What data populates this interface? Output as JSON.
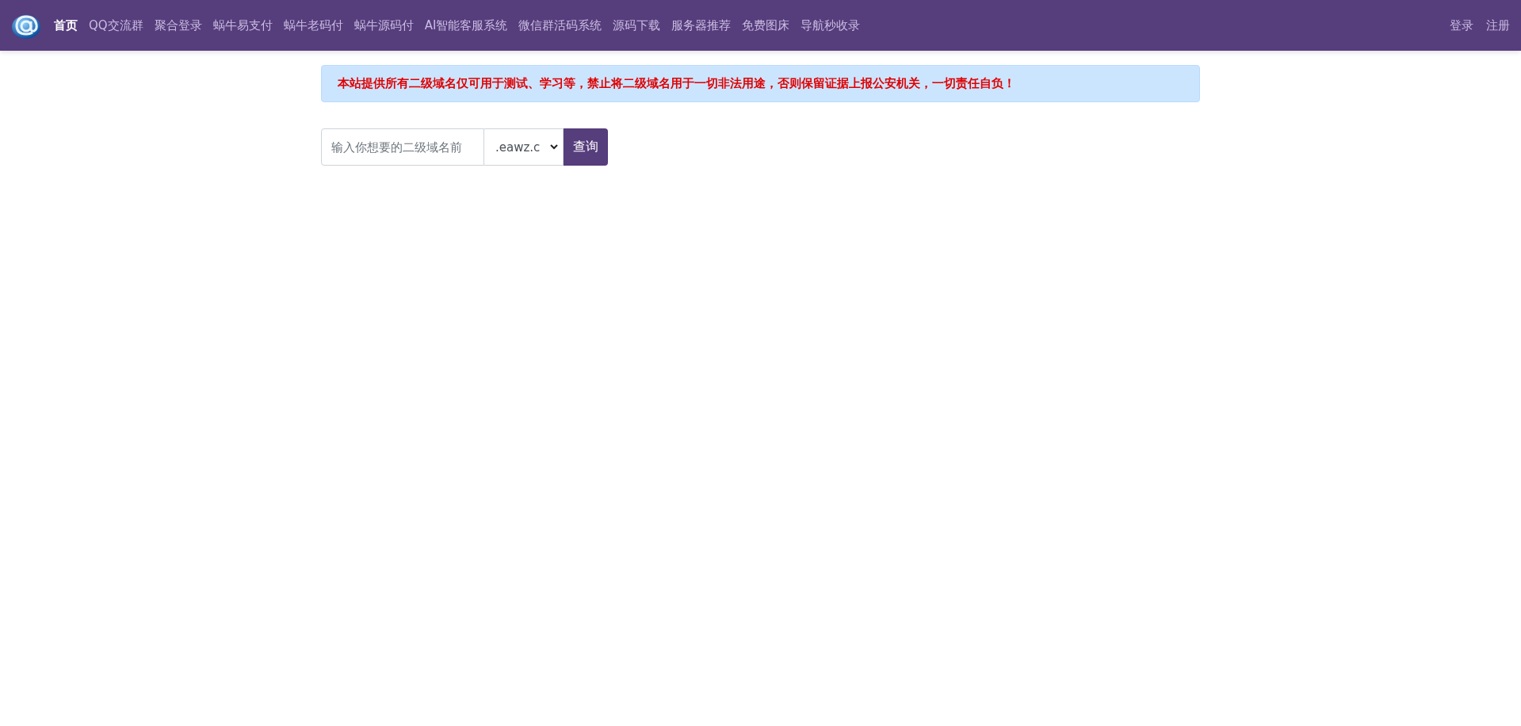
{
  "navbar": {
    "items": [
      {
        "label": "首页",
        "selected": true
      },
      {
        "label": "QQ交流群",
        "selected": false
      },
      {
        "label": "聚合登录",
        "selected": false
      },
      {
        "label": "蜗牛易支付",
        "selected": false
      },
      {
        "label": "蜗牛老码付",
        "selected": false
      },
      {
        "label": "蜗牛源码付",
        "selected": false
      },
      {
        "label": "AI智能客服系统",
        "selected": false
      },
      {
        "label": "微信群活码系统",
        "selected": false
      },
      {
        "label": "源码下载",
        "selected": false
      },
      {
        "label": "服务器推荐",
        "selected": false
      },
      {
        "label": "免费图床",
        "selected": false
      },
      {
        "label": "导航秒收录",
        "selected": false
      }
    ],
    "right_items": [
      "登录",
      "注册"
    ]
  },
  "alert": {
    "text": "本站提供所有二级域名仅可用于测试、学习等，禁止将二级域名用于一切非法用途，否则保留证据上报公安机关，一切责任自负！"
  },
  "search": {
    "placeholder": "输入你想要的二级域名前",
    "suffix": ".eawz.c",
    "button": "查询"
  }
}
